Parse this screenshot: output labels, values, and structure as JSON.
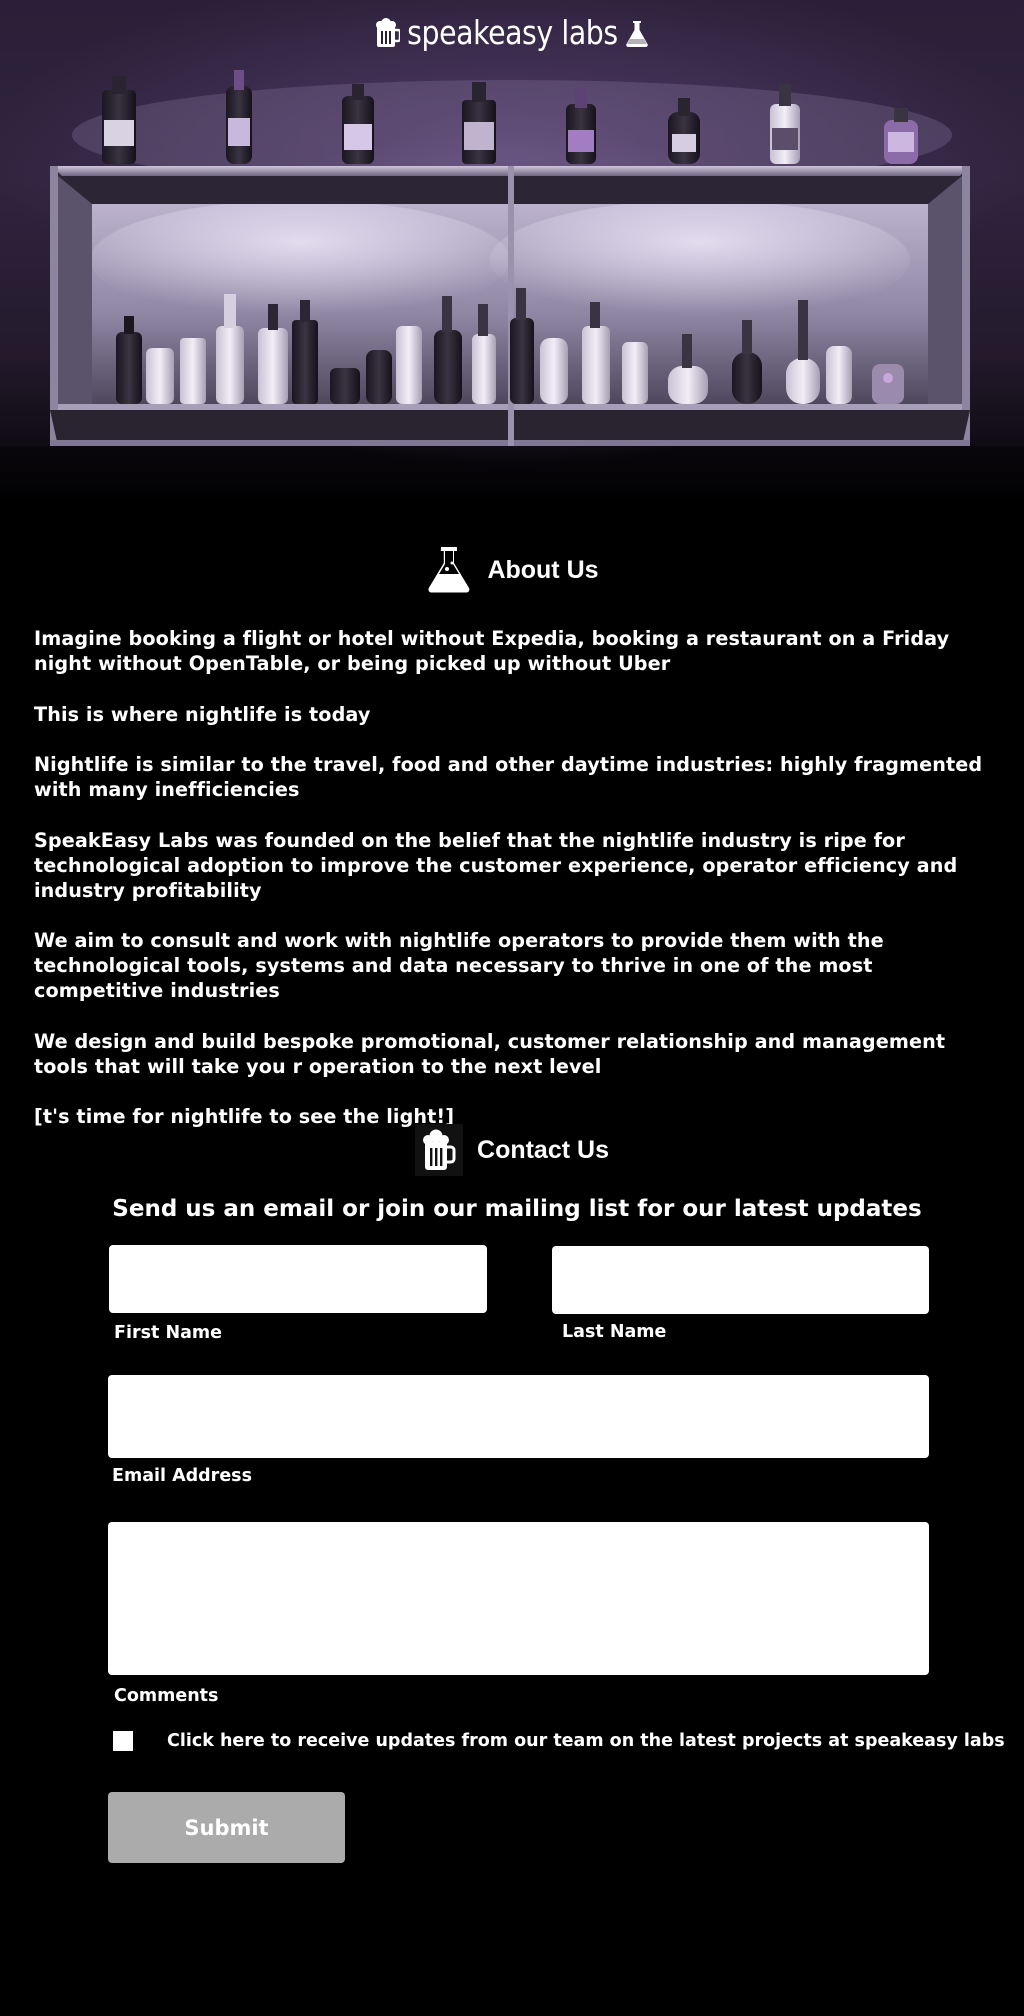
{
  "header": {
    "logo_text": "speakeasy labs",
    "logo_left_icon": "beer-mug-icon",
    "logo_right_icon": "flask-icon"
  },
  "about": {
    "icon": "flask-icon",
    "heading": "About Us",
    "paragraphs": [
      "Imagine booking a flight or hotel without Expedia, booking a restaurant on a Friday night without OpenTable, or being picked up without Uber",
      "This is where nightlife is today",
      "Nightlife is similar to the travel, food and other daytime industries: highly fragmented with many inefficiencies",
      "SpeakEasy Labs was founded on the belief that the nightlife industry is ripe for technological adoption to improve the customer experience, operator efficiency and industry profitability",
      "We aim to consult and work with nightlife operators to provide them with the technological tools, systems and data necessary to thrive in one of the most competitive industries",
      "We design and build bespoke promotional, customer relationship and management tools that will take you r operation to the next level",
      "[t's time for nightlife to see the light!]"
    ]
  },
  "contact": {
    "icon": "beer-mug-icon",
    "heading": "Contact Us",
    "subheading": "Send us an email or join our mailing list for our latest updates",
    "first_name": {
      "label": "First Name",
      "value": ""
    },
    "last_name": {
      "label": "Last Name",
      "value": ""
    },
    "email": {
      "label": "Email Address",
      "value": ""
    },
    "comments": {
      "label": "Comments",
      "value": ""
    },
    "updates_checkbox": {
      "label": "Click here to receive updates from our team on the latest projects at speakeasy labs",
      "checked": false
    },
    "submit_label": "Submit"
  },
  "colors": {
    "background": "#000000",
    "hero_purple": "#2a1f37",
    "field_background": "#ffffff",
    "submit_background": "#ababab"
  }
}
